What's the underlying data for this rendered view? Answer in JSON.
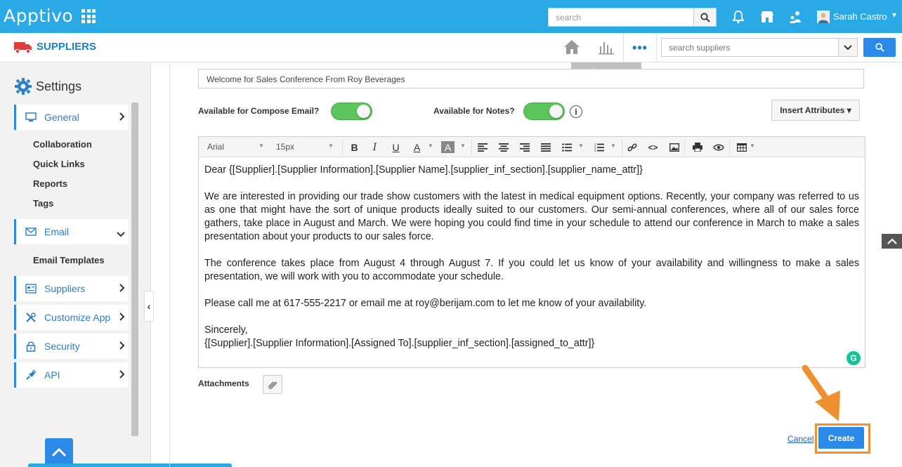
{
  "app": {
    "logo": "Apptivo",
    "search_placeholder": "search",
    "user_name": "Sarah Castro"
  },
  "module": {
    "title": "SUPPLIERS",
    "search_placeholder": "search suppliers",
    "reports_tooltip": "Reports"
  },
  "sidebar": {
    "heading": "Settings",
    "items": [
      {
        "label": "General",
        "icon": "monitor-icon"
      },
      {
        "label": "Email",
        "icon": "envelope-icon"
      },
      {
        "label": "Suppliers",
        "icon": "card-icon"
      },
      {
        "label": "Customize App",
        "icon": "tools-icon"
      },
      {
        "label": "Security",
        "icon": "lock-icon"
      },
      {
        "label": "API",
        "icon": "plug-icon"
      }
    ],
    "general_sub": [
      "Collaboration",
      "Quick Links",
      "Reports",
      "Tags"
    ],
    "email_sub": [
      "Email Templates"
    ]
  },
  "form": {
    "subject": "Welcome for Sales Conference From Roy Beverages",
    "compose_label": "Available for Compose Email?",
    "notes_label": "Available for Notes?",
    "compose_enabled": true,
    "notes_enabled": true,
    "insert_attributes": "Insert Attributes",
    "attachments_label": "Attachments",
    "cancel": "Cancel",
    "create": "Create"
  },
  "editor": {
    "font": "Arial",
    "size": "15px",
    "body": [
      "Dear {[Supplier].[Supplier Information].[Supplier Name].[supplier_inf_section].[supplier_name_attr]}",
      "We are interested in providing our trade show customers with the latest in medical equipment options. Recently, your company was referred to us as one that might have the sort of unique products ideally suited to our customers. Our semi-annual conferences, where all of our sales force gathers, take place in August and March. We were hoping you could find time in your schedule to attend our conference in March to make a sales presentation about your products to our sales force.",
      "The conference takes place from August 4 through August 7. If you could let us know of your availability and willingness to make a sales presentation, we will work with you to accommodate your schedule.",
      "Please call me at 617-555-2217 or email me at roy@berijam.com to let me know of your availability.",
      "Sincerely,",
      "{[Supplier].[Supplier Information].[Assigned To].[supplier_inf_section].[assigned_to_attr]}"
    ]
  },
  "colors": {
    "topbar": "#29a9e6",
    "accent": "#2b8ae8",
    "toggle_on": "#5cc45c",
    "highlight": "#ee9030"
  }
}
